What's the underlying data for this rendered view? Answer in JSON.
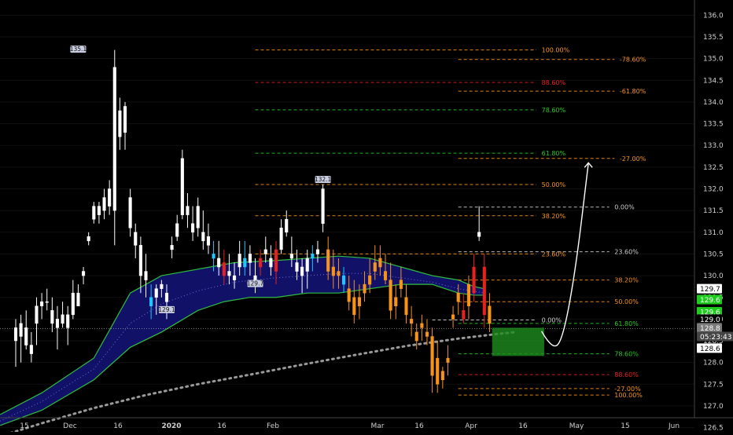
{
  "chart_data": {
    "type": "candlestick",
    "ylim": [
      126.4,
      136.2
    ],
    "y_ticks": [
      "126.5",
      "127.0",
      "127.5",
      "128.0",
      "128.5",
      "129.0",
      "129.5",
      "130.0",
      "130.5",
      "131.0",
      "131.5",
      "132.0",
      "132.5",
      "133.0",
      "133.5",
      "134.0",
      "134.5",
      "135.0",
      "135.5",
      "136.0"
    ],
    "x_ticks": [
      "15",
      "Dec",
      "16",
      "2020",
      "16",
      "Feb",
      "Mar",
      "16",
      "Apr",
      "16",
      "May",
      "15",
      "Jun"
    ],
    "price_labels": [
      {
        "text": "129.7",
        "y": 129.7,
        "color": "#ffffff",
        "text_color": "#000000"
      },
      {
        "text": "129.6",
        "y": 129.45,
        "color": "#1ecc1e",
        "text_color": "#ffffff"
      },
      {
        "text": "129.6",
        "y": 129.17,
        "color": "#1ecc1e",
        "text_color": "#ffffff"
      },
      {
        "text": "129.0",
        "y": 129.0,
        "color": "#000000",
        "text_color": "#ffffff"
      },
      {
        "text": "128.8",
        "y": 128.8,
        "color": "#7a7a7a",
        "text_color": "#ffffff"
      },
      {
        "text": "05:23:43",
        "y": 128.6,
        "color": "#444444",
        "text_color": "#ffffff"
      },
      {
        "text": "128.6",
        "y": 128.33,
        "color": "#ffffff",
        "text_color": "#000000"
      }
    ],
    "candle_annotations": [
      {
        "text": "135.1",
        "x": 12,
        "y": 135.1
      },
      {
        "text": "132.1",
        "x": 59,
        "y": 132.1
      },
      {
        "text": "129.7",
        "x": 46,
        "y": 129.7
      },
      {
        "text": "129.1",
        "x": 29,
        "y": 129.1
      }
    ],
    "fib_sets": [
      {
        "x0": 46,
        "x1": 100,
        "label_x": 101,
        "levels": [
          {
            "label": "100.00%",
            "price": 135.2,
            "color": "#f7931a"
          },
          {
            "label": "88.60%",
            "price": 134.45,
            "color": "#e82020"
          },
          {
            "label": "78.60%",
            "price": 133.82,
            "color": "#28c828"
          },
          {
            "label": "61.80%",
            "price": 132.82,
            "color": "#28c828"
          },
          {
            "label": "50.00%",
            "price": 132.1,
            "color": "#f7931a"
          },
          {
            "label": "38.20%",
            "price": 131.38,
            "color": "#f7931a"
          },
          {
            "label": "23.60%",
            "price": 130.5,
            "color": "#f7931a"
          }
        ]
      },
      {
        "x0": 85,
        "x1": 115,
        "label_x": 116,
        "levels": [
          {
            "label": "-78.60%",
            "price": 134.98,
            "color": "#f7931a"
          },
          {
            "label": "-61.80%",
            "price": 134.25,
            "color": "#f7931a"
          },
          {
            "label": "-27.00%",
            "price": 132.7,
            "color": "#f7931a"
          }
        ]
      },
      {
        "x0": 85,
        "x1": 114,
        "label_x": 115,
        "levels": [
          {
            "label": "0.00%",
            "price": 131.58,
            "color": "#cfcfcf"
          },
          {
            "label": "23.60%",
            "price": 130.55,
            "color": "#cfcfcf"
          },
          {
            "label": "38.20%",
            "price": 129.9,
            "color": "#f7931a"
          },
          {
            "label": "50.00%",
            "price": 129.4,
            "color": "#f7931a"
          },
          {
            "label": "61.80%",
            "price": 128.9,
            "color": "#28c828"
          },
          {
            "label": "78.60%",
            "price": 128.2,
            "color": "#28c828"
          },
          {
            "label": "88.60%",
            "price": 127.72,
            "color": "#e82020"
          },
          {
            "label": "-27.00%",
            "price": 127.4,
            "color": "#f7931a"
          },
          {
            "label": "100.00%",
            "price": 127.25,
            "color": "#f7931a"
          }
        ]
      },
      {
        "x0": 80,
        "x1": 100,
        "label_x": 101,
        "levels": [
          {
            "label": "0.00%",
            "price": 128.98,
            "color": "#cfcfcf"
          }
        ]
      }
    ],
    "current_price": 128.78,
    "target_box": {
      "x0": 91.5,
      "x1": 101.5,
      "y0": 128.8,
      "y1": 128.15,
      "color": "#1e8c1e"
    },
    "projection_path": [
      [
        101,
        128.72
      ],
      [
        103,
        128.3
      ],
      [
        105,
        128.5
      ],
      [
        107.5,
        130.1
      ],
      [
        110,
        132.6
      ]
    ],
    "cloud": {
      "upper": [
        [
          -3,
          126.8
        ],
        [
          5,
          127.3
        ],
        [
          15,
          128.1
        ],
        [
          22,
          129.6
        ],
        [
          28,
          130.0
        ],
        [
          35,
          130.15
        ],
        [
          42,
          130.3
        ],
        [
          50,
          130.35
        ],
        [
          56,
          130.4
        ],
        [
          62,
          130.45
        ],
        [
          68,
          130.4
        ],
        [
          74,
          130.2
        ],
        [
          80,
          130.0
        ],
        [
          85,
          129.9
        ],
        [
          88,
          129.75
        ],
        [
          90,
          129.7
        ]
      ],
      "lower": [
        [
          90,
          129.55
        ],
        [
          88,
          129.55
        ],
        [
          85,
          129.6
        ],
        [
          80,
          129.8
        ],
        [
          74,
          129.8
        ],
        [
          68,
          129.7
        ],
        [
          62,
          129.6
        ],
        [
          56,
          129.6
        ],
        [
          50,
          129.5
        ],
        [
          45,
          129.5
        ],
        [
          40,
          129.4
        ],
        [
          35,
          129.2
        ],
        [
          28,
          128.7
        ],
        [
          22,
          128.35
        ],
        [
          15,
          127.6
        ],
        [
          5,
          126.9
        ],
        [
          -3,
          126.55
        ]
      ],
      "mid": [
        [
          -3,
          126.65
        ],
        [
          5,
          127.1
        ],
        [
          15,
          127.85
        ],
        [
          22,
          128.9
        ],
        [
          28,
          129.35
        ],
        [
          35,
          129.65
        ],
        [
          42,
          129.85
        ],
        [
          50,
          129.95
        ],
        [
          56,
          130.0
        ],
        [
          62,
          130.05
        ],
        [
          68,
          130.05
        ],
        [
          74,
          129.95
        ],
        [
          80,
          129.85
        ],
        [
          85,
          129.7
        ],
        [
          90,
          129.6
        ]
      ]
    },
    "dotted_ma": [
      [
        -3,
        126.3
      ],
      [
        5,
        126.6
      ],
      [
        15,
        126.95
      ],
      [
        25,
        127.25
      ],
      [
        35,
        127.5
      ],
      [
        45,
        127.72
      ],
      [
        55,
        127.95
      ],
      [
        65,
        128.17
      ],
      [
        75,
        128.38
      ],
      [
        85,
        128.55
      ],
      [
        92,
        128.65
      ],
      [
        96,
        128.7
      ]
    ],
    "candles": [
      {
        "x": 0,
        "o": 128.5,
        "h": 129.0,
        "l": 127.9,
        "c": 128.8
      },
      {
        "x": 1,
        "o": 128.6,
        "h": 129.1,
        "l": 128.0,
        "c": 128.9
      },
      {
        "x": 2,
        "o": 128.8,
        "h": 129.2,
        "l": 128.3,
        "c": 128.4
      },
      {
        "x": 3,
        "o": 128.4,
        "h": 128.7,
        "l": 128.0,
        "c": 128.2
      },
      {
        "x": 4,
        "o": 128.9,
        "h": 129.5,
        "l": 128.4,
        "c": 129.3
      },
      {
        "x": 5,
        "o": 129.3,
        "h": 129.6,
        "l": 129.0,
        "c": 129.4
      },
      {
        "x": 6,
        "o": 129.4,
        "h": 129.7,
        "l": 129.2,
        "c": 129.4
      },
      {
        "x": 7,
        "o": 129.2,
        "h": 129.5,
        "l": 128.7,
        "c": 128.9
      },
      {
        "x": 8,
        "o": 128.8,
        "h": 129.3,
        "l": 128.3,
        "c": 129.0
      },
      {
        "x": 9,
        "o": 129.1,
        "h": 129.4,
        "l": 128.8,
        "c": 128.9
      },
      {
        "x": 10,
        "o": 128.8,
        "h": 129.3,
        "l": 128.4,
        "c": 129.1
      },
      {
        "x": 11,
        "o": 129.1,
        "h": 129.9,
        "l": 129.0,
        "c": 129.6
      },
      {
        "x": 12,
        "o": 129.6,
        "h": 129.8,
        "l": 129.3,
        "c": 129.3
      },
      {
        "x": 13,
        "o": 130.0,
        "h": 130.2,
        "l": 129.8,
        "c": 130.1
      },
      {
        "x": 14,
        "o": 130.8,
        "h": 131.0,
        "l": 130.7,
        "c": 130.9
      },
      {
        "x": 15,
        "o": 131.3,
        "h": 131.7,
        "l": 131.2,
        "c": 131.6
      },
      {
        "x": 16,
        "o": 131.4,
        "h": 131.7,
        "l": 131.2,
        "c": 131.6
      },
      {
        "x": 17,
        "o": 131.5,
        "h": 132.0,
        "l": 131.3,
        "c": 131.8
      },
      {
        "x": 18,
        "o": 131.6,
        "h": 132.2,
        "l": 131.4,
        "c": 132.0
      },
      {
        "x": 19,
        "o": 131.5,
        "h": 135.2,
        "l": 130.7,
        "c": 134.8
      },
      {
        "x": 20,
        "o": 133.2,
        "h": 134.1,
        "l": 132.9,
        "c": 133.8
      },
      {
        "x": 21,
        "o": 133.3,
        "h": 134.0,
        "l": 132.9,
        "c": 133.9
      },
      {
        "x": 22,
        "o": 131.8,
        "h": 132.0,
        "l": 130.9,
        "c": 131.1
      },
      {
        "x": 23,
        "o": 131.0,
        "h": 131.2,
        "l": 130.4,
        "c": 130.7
      },
      {
        "x": 24,
        "o": 130.7,
        "h": 130.9,
        "l": 129.6,
        "c": 130.0
      },
      {
        "x": 25,
        "o": 130.1,
        "h": 130.5,
        "l": 129.5,
        "c": 129.9
      },
      {
        "x": 26,
        "o": 129.5,
        "h": 129.8,
        "l": 129.0,
        "c": 129.3
      },
      {
        "x": 27,
        "o": 129.5,
        "h": 129.8,
        "l": 129.1,
        "c": 129.7
      },
      {
        "x": 28,
        "o": 129.7,
        "h": 129.9,
        "l": 129.5,
        "c": 129.8
      },
      {
        "x": 29,
        "o": 129.4,
        "h": 129.8,
        "l": 129.0,
        "c": 129.6
      },
      {
        "x": 30,
        "o": 130.6,
        "h": 130.9,
        "l": 130.4,
        "c": 130.7
      },
      {
        "x": 31,
        "o": 130.9,
        "h": 131.4,
        "l": 130.8,
        "c": 131.2
      },
      {
        "x": 32,
        "o": 131.4,
        "h": 132.9,
        "l": 131.3,
        "c": 132.7
      },
      {
        "x": 33,
        "o": 131.6,
        "h": 131.9,
        "l": 131.1,
        "c": 131.4
      },
      {
        "x": 34,
        "o": 131.2,
        "h": 131.6,
        "l": 130.8,
        "c": 131.0
      },
      {
        "x": 35,
        "o": 131.1,
        "h": 131.8,
        "l": 130.9,
        "c": 131.6
      },
      {
        "x": 36,
        "o": 131.0,
        "h": 131.5,
        "l": 130.6,
        "c": 130.8
      },
      {
        "x": 37,
        "o": 130.9,
        "h": 131.2,
        "l": 130.5,
        "c": 130.7
      },
      {
        "x": 38,
        "o": 130.5,
        "h": 130.8,
        "l": 130.1,
        "c": 130.4
      },
      {
        "x": 39,
        "o": 130.4,
        "h": 130.8,
        "l": 130.0,
        "c": 130.2
      },
      {
        "x": 40,
        "o": 130.0,
        "h": 130.6,
        "l": 129.8,
        "c": 130.3
      },
      {
        "x": 41,
        "o": 130.1,
        "h": 130.5,
        "l": 129.8,
        "c": 130.0
      },
      {
        "x": 42,
        "o": 130.0,
        "h": 130.3,
        "l": 129.7,
        "c": 129.9
      },
      {
        "x": 43,
        "o": 130.2,
        "h": 130.8,
        "l": 130.0,
        "c": 130.5
      },
      {
        "x": 44,
        "o": 130.4,
        "h": 130.8,
        "l": 130.0,
        "c": 130.2
      },
      {
        "x": 45,
        "o": 130.3,
        "h": 130.7,
        "l": 130.0,
        "c": 130.5
      },
      {
        "x": 46,
        "o": 130.0,
        "h": 130.4,
        "l": 129.6,
        "c": 129.8
      },
      {
        "x": 47,
        "o": 130.2,
        "h": 130.6,
        "l": 130.0,
        "c": 130.4
      },
      {
        "x": 48,
        "o": 130.6,
        "h": 130.9,
        "l": 130.3,
        "c": 130.5
      },
      {
        "x": 49,
        "o": 130.4,
        "h": 130.7,
        "l": 130.0,
        "c": 130.2
      },
      {
        "x": 50,
        "o": 130.1,
        "h": 130.8,
        "l": 129.8,
        "c": 130.6
      },
      {
        "x": 51,
        "o": 130.6,
        "h": 131.3,
        "l": 130.5,
        "c": 131.1
      },
      {
        "x": 52,
        "o": 131.0,
        "h": 131.5,
        "l": 130.9,
        "c": 131.3
      },
      {
        "x": 53,
        "o": 130.5,
        "h": 130.9,
        "l": 130.2,
        "c": 130.4
      },
      {
        "x": 54,
        "o": 130.3,
        "h": 130.6,
        "l": 129.9,
        "c": 130.1
      },
      {
        "x": 55,
        "o": 130.0,
        "h": 130.4,
        "l": 129.6,
        "c": 130.2
      },
      {
        "x": 56,
        "o": 130.1,
        "h": 130.6,
        "l": 129.7,
        "c": 130.4
      },
      {
        "x": 57,
        "o": 130.4,
        "h": 130.7,
        "l": 130.1,
        "c": 130.5
      },
      {
        "x": 58,
        "o": 130.5,
        "h": 130.8,
        "l": 130.3,
        "c": 130.6
      },
      {
        "x": 59,
        "o": 131.2,
        "h": 132.1,
        "l": 131.0,
        "c": 132.0
      },
      {
        "x": 60,
        "o": 130.6,
        "h": 130.9,
        "l": 129.9,
        "c": 130.1
      },
      {
        "x": 61,
        "o": 130.2,
        "h": 130.6,
        "l": 129.7,
        "c": 130.0
      },
      {
        "x": 62,
        "o": 130.0,
        "h": 130.4,
        "l": 129.7,
        "c": 130.1
      },
      {
        "x": 63,
        "o": 130.0,
        "h": 130.2,
        "l": 129.6,
        "c": 129.8
      },
      {
        "x": 64,
        "o": 129.7,
        "h": 130.0,
        "l": 129.2,
        "c": 129.4
      },
      {
        "x": 65,
        "o": 129.5,
        "h": 129.9,
        "l": 128.9,
        "c": 129.1
      },
      {
        "x": 66,
        "o": 129.5,
        "h": 129.8,
        "l": 129.0,
        "c": 129.3
      },
      {
        "x": 67,
        "o": 129.8,
        "h": 130.1,
        "l": 129.4,
        "c": 129.6
      },
      {
        "x": 68,
        "o": 130.0,
        "h": 130.4,
        "l": 129.6,
        "c": 129.8
      },
      {
        "x": 69,
        "o": 130.3,
        "h": 130.7,
        "l": 129.9,
        "c": 130.1
      },
      {
        "x": 70,
        "o": 130.4,
        "h": 130.7,
        "l": 130.0,
        "c": 130.2
      },
      {
        "x": 71,
        "o": 130.1,
        "h": 130.5,
        "l": 129.8,
        "c": 129.9
      },
      {
        "x": 72,
        "o": 129.9,
        "h": 130.3,
        "l": 129.0,
        "c": 129.2
      },
      {
        "x": 73,
        "o": 129.5,
        "h": 129.8,
        "l": 129.0,
        "c": 129.3
      },
      {
        "x": 74,
        "o": 129.9,
        "h": 130.2,
        "l": 129.5,
        "c": 129.7
      },
      {
        "x": 75,
        "o": 129.5,
        "h": 129.8,
        "l": 128.9,
        "c": 129.1
      },
      {
        "x": 76,
        "o": 129.0,
        "h": 129.3,
        "l": 128.6,
        "c": 128.9
      },
      {
        "x": 77,
        "o": 128.7,
        "h": 128.9,
        "l": 128.3,
        "c": 128.5
      },
      {
        "x": 78,
        "o": 128.9,
        "h": 129.1,
        "l": 128.5,
        "c": 128.8
      },
      {
        "x": 79,
        "o": 128.7,
        "h": 129.0,
        "l": 128.4,
        "c": 128.6
      },
      {
        "x": 80,
        "o": 128.6,
        "h": 128.8,
        "l": 127.3,
        "c": 127.7
      },
      {
        "x": 81,
        "o": 128.1,
        "h": 128.5,
        "l": 127.3,
        "c": 127.5
      },
      {
        "x": 82,
        "o": 127.6,
        "h": 127.9,
        "l": 127.4,
        "c": 127.8
      },
      {
        "x": 83,
        "o": 128.0,
        "h": 128.4,
        "l": 127.7,
        "c": 128.1
      },
      {
        "x": 84,
        "o": 129.0,
        "h": 129.3,
        "l": 128.8,
        "c": 129.1
      },
      {
        "x": 85,
        "o": 129.4,
        "h": 129.8,
        "l": 129.1,
        "c": 129.6
      },
      {
        "x": 86,
        "o": 129.2,
        "h": 129.6,
        "l": 128.9,
        "c": 129.0
      },
      {
        "x": 87,
        "o": 129.3,
        "h": 130.0,
        "l": 129.0,
        "c": 129.8
      },
      {
        "x": 88,
        "o": 130.2,
        "h": 130.5,
        "l": 129.4,
        "c": 129.6
      },
      {
        "x": 89,
        "o": 130.9,
        "h": 131.6,
        "l": 130.8,
        "c": 131.0
      },
      {
        "x": 90,
        "o": 130.2,
        "h": 130.5,
        "l": 128.8,
        "c": 129.1
      },
      {
        "x": 91,
        "o": 129.3,
        "h": 129.6,
        "l": 128.7,
        "c": 128.9
      }
    ]
  }
}
